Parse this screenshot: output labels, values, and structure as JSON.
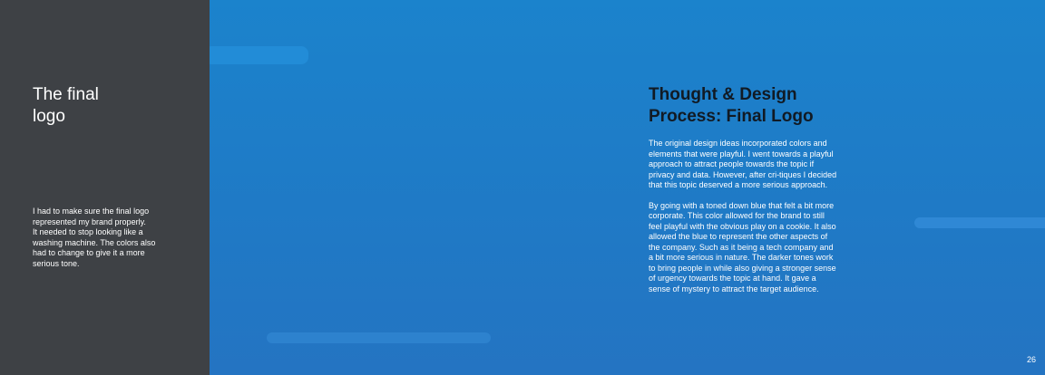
{
  "sidebar": {
    "title": "The final\nlogo",
    "body": "I had to make sure the final logo\nrepresented my brand properly.\nIt needed to stop looking like a\nwashing machine. The colors also\nhad to change to give it a more\nserious tone."
  },
  "main": {
    "title": "Thought & Design Process: Final Logo",
    "paragraphs": [
      "The original design ideas incorporated colors and elements that were playful. I went towards a playful approach to attract people towards the topic if privacy and data. However, after cri-tiques I decided that this topic deserved a more serious approach.",
      "By going with a toned down blue that felt a bit more corporate. This color allowed for the brand to still feel playful with the obvious play on a cookie. It also allowed the blue to represent the other aspects of the company. Such as it being a tech company and a bit more serious in nature. The darker tones work to bring people in while also giving a stronger sense of urgency towards the topic at hand. It gave a sense of mystery to attract the target audience."
    ]
  },
  "page_number": "26",
  "colors": {
    "sidebar_bg": "#3e4145",
    "main_bg": "#1e78c8",
    "title_text": "#111a24",
    "body_text": "#ffffff"
  }
}
